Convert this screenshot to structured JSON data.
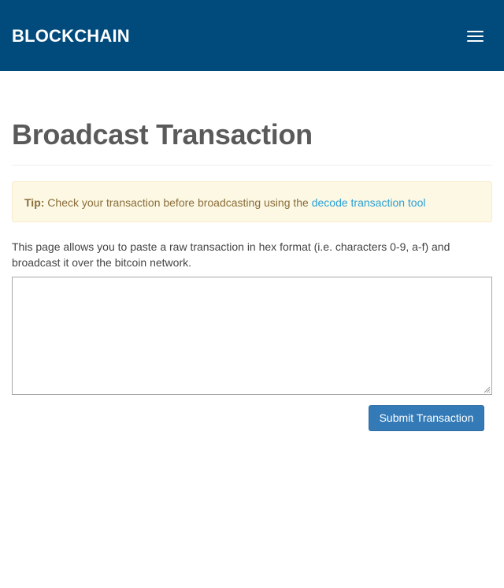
{
  "navbar": {
    "brand": "BLOCKCHAIN",
    "menu_icon": "hamburger-menu-icon",
    "background_color": "#004a7c"
  },
  "main": {
    "title": "Broadcast Transaction",
    "tip": {
      "label": "Tip:",
      "text": " Check your transaction before broadcasting using the ",
      "link_text": "decode transaction tool",
      "background_color": "#fcf8e3",
      "text_color": "#8a6d3b",
      "link_color": "#2a9fd6"
    },
    "description": "This page allows you to paste a raw transaction in hex format (i.e. characters 0-9, a-f) and broadcast it over the bitcoin network.",
    "transaction_input": {
      "value": "",
      "placeholder": ""
    },
    "submit_label": "Submit Transaction",
    "submit_color": "#337ab7"
  }
}
